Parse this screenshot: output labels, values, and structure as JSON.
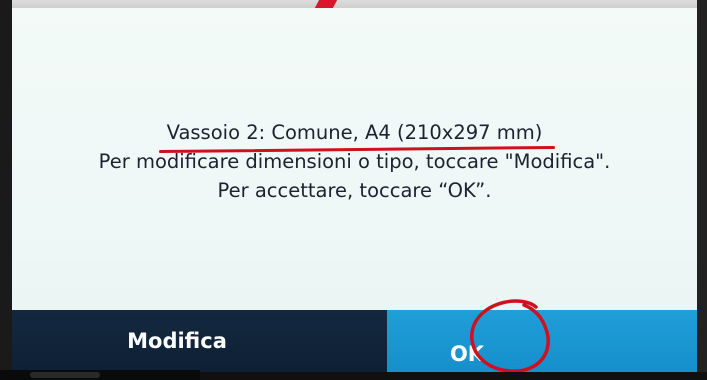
{
  "dialog": {
    "title": "Vassoio 2: Comune, A4 (210x297 mm)",
    "line2": "Per modificare dimensioni o tipo, toccare \"Modifica\".",
    "line3": "Per accettare, toccare “OK”."
  },
  "buttons": {
    "modifica_label": "Modifica",
    "ok_label": "OK"
  },
  "colors": {
    "screen_bg": "#eef8f6",
    "text": "#1c2230",
    "modifica_bg": "#0e2035",
    "ok_bg": "#1f9ed8",
    "annotation_red": "#d0101e"
  }
}
